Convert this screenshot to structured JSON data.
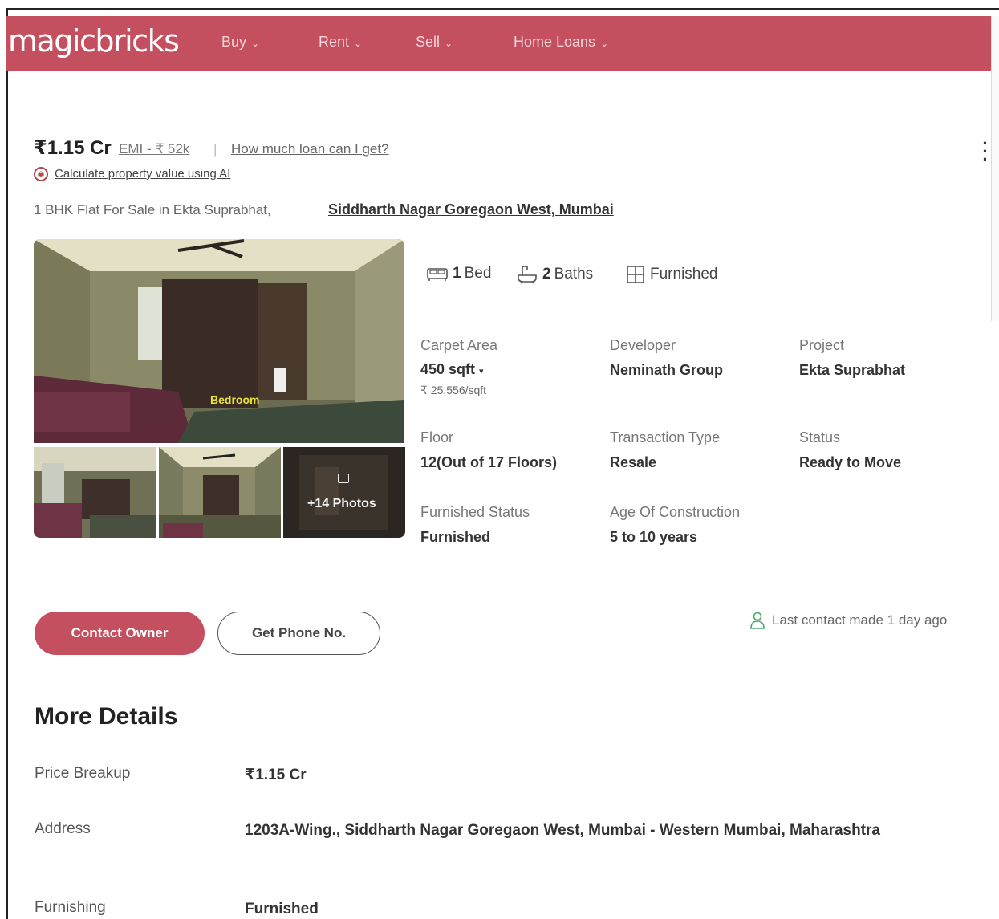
{
  "header": {
    "logo": "magicbricks",
    "nav": [
      {
        "label": "Buy"
      },
      {
        "label": "Rent"
      },
      {
        "label": "Sell"
      },
      {
        "label": "Home Loans"
      }
    ],
    "brand_color": "#c4505f"
  },
  "listing": {
    "price": "₹1.15 Cr",
    "emi": "EMI - ₹ 52k",
    "separator": "|",
    "loan_link": "How much loan can I get?",
    "calc_link": "Calculate property value using AI",
    "title_prefix": "1 BHK Flat For Sale in Ekta Suprabhat,",
    "title_location": "Siddharth Nagar Goregaon West, Mumbai",
    "main_photo_label": "Bedroom",
    "more_photos": "+14 Photos",
    "quick_facts": {
      "beds_num": "1",
      "beds_label": "Bed",
      "baths_num": "2",
      "baths_label": "Baths",
      "furnishing": "Furnished"
    },
    "summary": {
      "carpet_area_label": "Carpet Area",
      "carpet_area_value": "450 sqft",
      "carpet_area_rate": "₹ 25,556/sqft",
      "developer_label": "Developer",
      "developer_value": "Neminath Group",
      "project_label": "Project",
      "project_value": "Ekta Suprabhat",
      "floor_label": "Floor",
      "floor_value": "12(Out of 17 Floors)",
      "transaction_label": "Transaction Type",
      "transaction_value": "Resale",
      "status_label": "Status",
      "status_value": "Ready to Move",
      "furnished_status_label": "Furnished Status",
      "furnished_status_value": "Furnished",
      "age_label": "Age Of Construction",
      "age_value": "5 to 10 years"
    },
    "actions": {
      "contact_owner": "Contact Owner",
      "get_phone": "Get Phone No.",
      "last_contact": "Last contact made 1 day ago"
    }
  },
  "more_details": {
    "title": "More Details",
    "rows": [
      {
        "label": "Price Breakup",
        "value": "₹1.15 Cr"
      },
      {
        "label": "Address",
        "value": "1203A-Wing., Siddharth Nagar Goregaon West, Mumbai - Western Mumbai, Maharashtra"
      },
      {
        "label": "Furnishing",
        "value": "Furnished"
      }
    ]
  }
}
